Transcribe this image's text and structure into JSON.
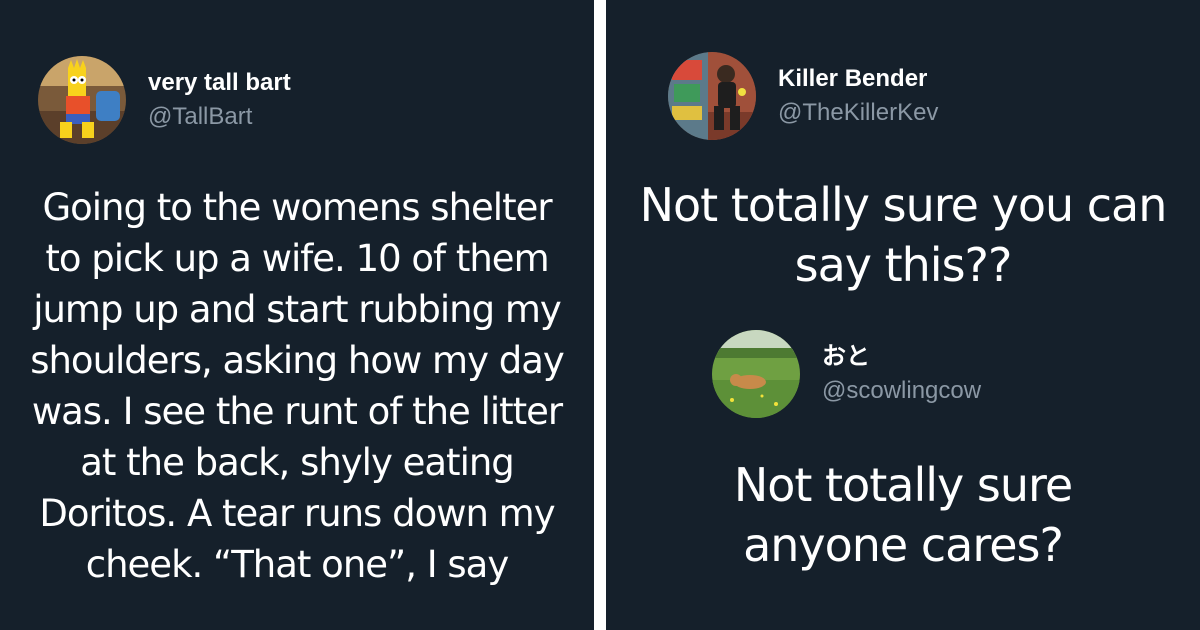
{
  "left_tweet": {
    "display_name": "very tall bart",
    "handle": "@TallBart",
    "text": "Going to the womens shelter to pick up a wife. 10 of them jump up and start rubbing my shoulders, asking how my day was. I see the runt of the litter at the back, shyly eating Doritos. A tear runs down my cheek. “That one”, I say",
    "avatar_icon": "cartoon-character-avatar"
  },
  "right_tweet": {
    "display_name": "Killer Bender",
    "handle": "@TheKillerKev",
    "text": "Not totally sure you can say this??",
    "avatar_icon": "photo-avatar"
  },
  "quoted_tweet": {
    "display_name": "おと",
    "handle": "@scowlingcow",
    "text": "Not totally sure anyone cares?",
    "avatar_icon": "dog-in-grass-avatar"
  },
  "colors": {
    "background": "#15202b",
    "text": "#ffffff",
    "handle": "#8b98a5",
    "divider": "#ffffff"
  }
}
